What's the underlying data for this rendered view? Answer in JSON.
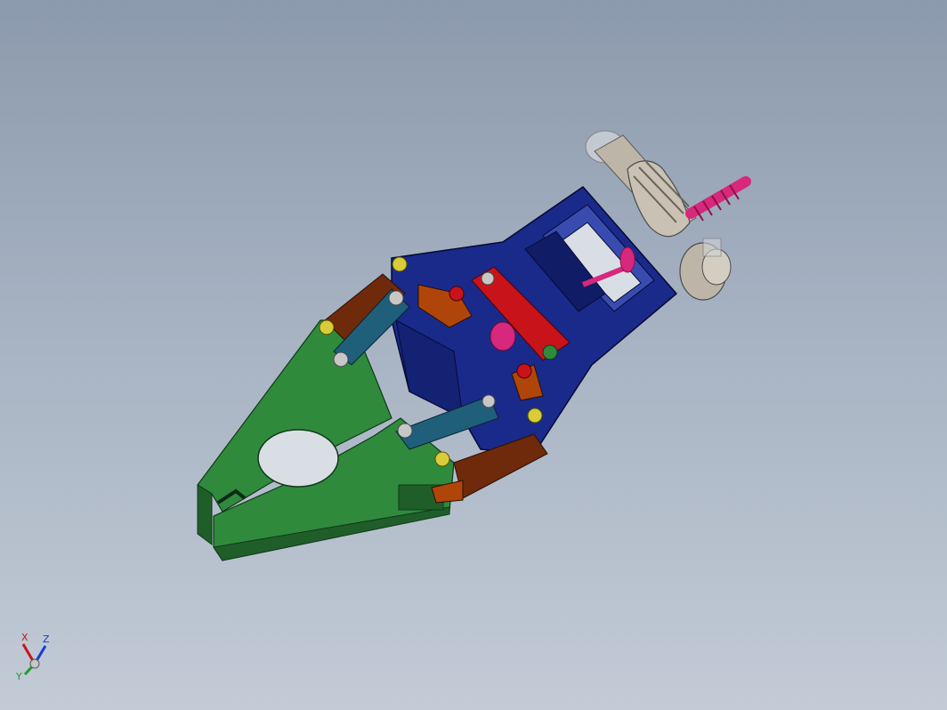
{
  "viewport": {
    "background_top": "#8c9aad",
    "background_bottom": "#c2cbd6"
  },
  "model": {
    "colors": {
      "jaw_green": "#2f8a3c",
      "jaw_green_dark": "#1f5e29",
      "frame_blue": "#1a2a8a",
      "link_orange": "#b0450a",
      "link_brown": "#6e2a0a",
      "link_teal": "#1f5f7a",
      "link_red": "#c8131b",
      "pin_yellow": "#d8cc3a",
      "pin_gray": "#c7c7c7",
      "shaft_magenta": "#d6287c",
      "gear_gray": "#bdb6a8"
    }
  },
  "triad": {
    "x_label": "X",
    "y_label": "Y",
    "z_label": "Z",
    "x_color": "#c4161c",
    "y_color": "#1e9e2a",
    "z_color": "#1a3ad0"
  }
}
